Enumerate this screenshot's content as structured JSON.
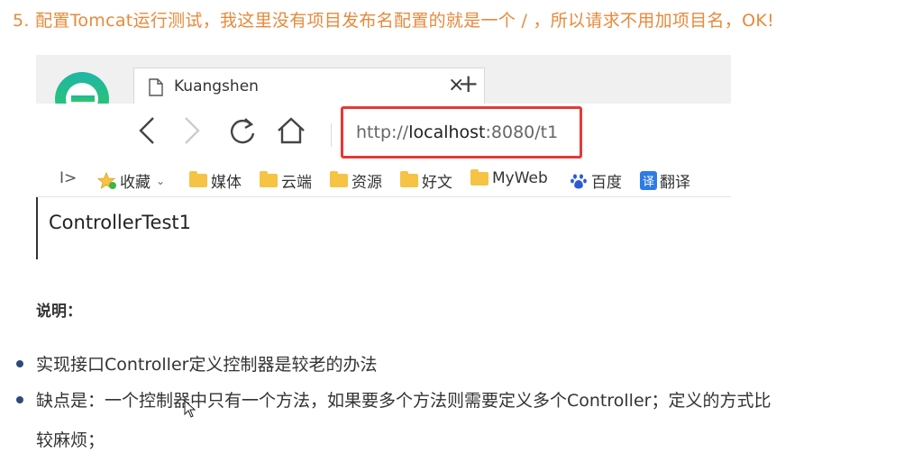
{
  "heading": "5. 配置Tomcat运行测试，我这里没有项目发布名配置的就是一个 / ，所以请求不用加项目名，OK!",
  "browser": {
    "tab_title": "Kuangshen",
    "tab_close": "×",
    "new_tab": "+",
    "url_prefix": "http://",
    "url_host": "localhost",
    "url_suffix": ":8080/t1",
    "bookmarks": {
      "sidebar": "I>",
      "favorites": "收藏",
      "items": [
        "媒体",
        "云端",
        "资源",
        "好文",
        "MyWeb"
      ],
      "baidu": "百度",
      "translate_badge": "译",
      "translate": "翻译"
    },
    "page_content": "ControllerTest1",
    "colors": {
      "highlight": "#e53935",
      "logo_top": "#1fb6a6",
      "logo_bottom": "#2fca5a"
    }
  },
  "note": {
    "title": "说明：",
    "items": [
      "实现接口Controller定义控制器是较老的办法",
      "缺点是：一个控制器中只有一个方法，如果要多个方法则需要定义多个Controller；定义的方式比",
      "较麻烦；"
    ]
  }
}
